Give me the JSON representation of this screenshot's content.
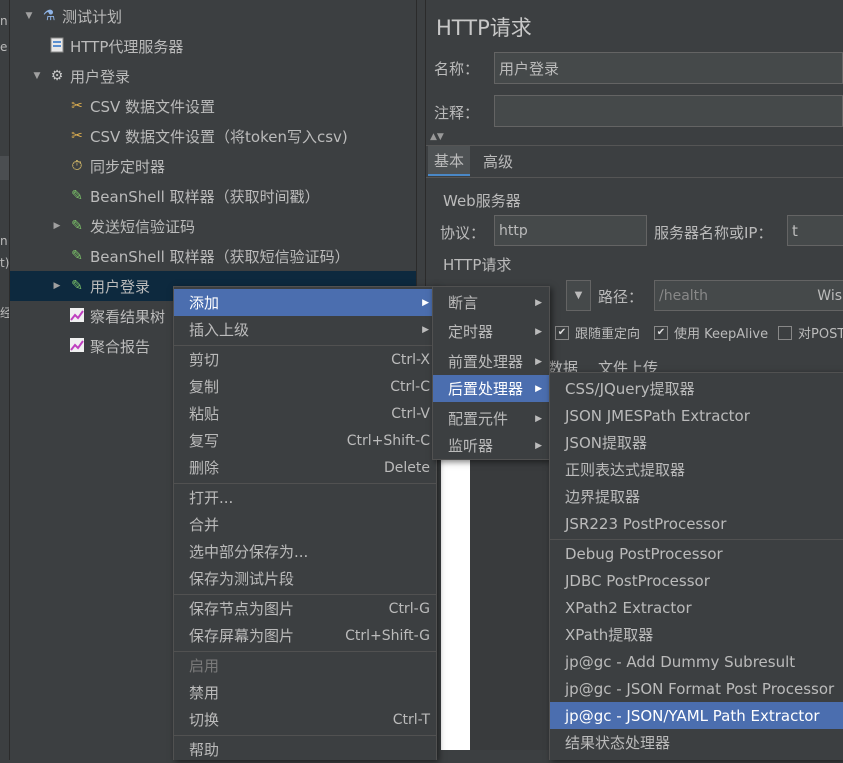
{
  "tree": {
    "nodes": [
      {
        "label": "测试计划",
        "icon": "flask-icon"
      },
      {
        "label": "HTTP代理服务器",
        "icon": "proxy-server-icon"
      },
      {
        "label": "用户登录",
        "icon": "gear-icon"
      },
      {
        "label": "CSV 数据文件设置",
        "icon": "wrench-icon"
      },
      {
        "label": "CSV 数据文件设置（将token写入csv)",
        "icon": "wrench-icon"
      },
      {
        "label": "同步定时器",
        "icon": "stopwatch-icon"
      },
      {
        "label": "BeanShell 取样器（获取时间戳）",
        "icon": "pipette-icon"
      },
      {
        "label": "发送短信验证码",
        "icon": "pipette-icon"
      },
      {
        "label": "BeanShell 取样器（获取短信验证码）",
        "icon": "pipette-icon"
      },
      {
        "label": "用户登录",
        "icon": "pipette-icon"
      },
      {
        "label": "察看结果树",
        "icon": "graph-icon"
      },
      {
        "label": "聚合报告",
        "icon": "graph-icon"
      }
    ]
  },
  "strip_fragments": [
    "n",
    "e",
    "n",
    "t)",
    "经"
  ],
  "http_panel": {
    "title": "HTTP请求",
    "name_label": "名称：",
    "name_value": "用户登录",
    "comment_label": "注释：",
    "comment_value": "",
    "tabs": [
      "基本",
      "高级"
    ],
    "web_server_section": "Web服务器",
    "protocol_label": "协议：",
    "protocol_value": "http",
    "server_label": "服务器名称或IP：",
    "server_value": "t",
    "http_section": "HTTP请求",
    "path_label": "路径：",
    "path_value": "/health",
    "path_tail": "Wis",
    "checkboxes": [
      {
        "label": "跟随重定向",
        "checked": true
      },
      {
        "label": "使用 KeepAlive",
        "checked": true
      },
      {
        "label": "对POST",
        "checked": false
      }
    ],
    "body_tabs": [
      "数据",
      "文件上传"
    ]
  },
  "context_menu": {
    "items": [
      {
        "label": "添加",
        "submenu": true,
        "highlight": true
      },
      {
        "label": "插入上级",
        "submenu": true
      },
      {
        "label": "剪切",
        "shortcut": "Ctrl-X"
      },
      {
        "label": "复制",
        "shortcut": "Ctrl-C"
      },
      {
        "label": "粘贴",
        "shortcut": "Ctrl-V"
      },
      {
        "label": "复写",
        "shortcut": "Ctrl+Shift-C"
      },
      {
        "label": "删除",
        "shortcut": "Delete"
      },
      {
        "label": "打开..."
      },
      {
        "label": "合并"
      },
      {
        "label": "选中部分保存为..."
      },
      {
        "label": "保存为测试片段"
      },
      {
        "label": "保存节点为图片",
        "shortcut": "Ctrl-G"
      },
      {
        "label": "保存屏幕为图片",
        "shortcut": "Ctrl+Shift-G"
      },
      {
        "label": "启用",
        "disabled": true
      },
      {
        "label": "禁用"
      },
      {
        "label": "切换",
        "shortcut": "Ctrl-T"
      },
      {
        "label": "帮助"
      }
    ]
  },
  "add_submenu": {
    "items": [
      {
        "label": "断言"
      },
      {
        "label": "定时器"
      },
      {
        "label": "前置处理器"
      },
      {
        "label": "后置处理器",
        "highlight": true
      },
      {
        "label": "配置元件"
      },
      {
        "label": "监听器"
      }
    ]
  },
  "post_processor_submenu": {
    "items": [
      {
        "label": "CSS/JQuery提取器"
      },
      {
        "label": "JSON JMESPath Extractor"
      },
      {
        "label": "JSON提取器"
      },
      {
        "label": "正则表达式提取器"
      },
      {
        "label": "边界提取器"
      },
      {
        "label": "JSR223 PostProcessor"
      },
      {
        "label": "Debug PostProcessor"
      },
      {
        "label": "JDBC PostProcessor"
      },
      {
        "label": "XPath2 Extractor"
      },
      {
        "label": "XPath提取器"
      },
      {
        "label": "jp@gc - Add Dummy Subresult"
      },
      {
        "label": "jp@gc - JSON Format Post Processor"
      },
      {
        "label": "jp@gc - JSON/YAML Path Extractor",
        "highlight": true
      },
      {
        "label": "结果状态处理器"
      }
    ]
  },
  "colors": {
    "background": "#3c3f41",
    "selection": "#0d293e",
    "menu_highlight": "#4b6eaf"
  }
}
